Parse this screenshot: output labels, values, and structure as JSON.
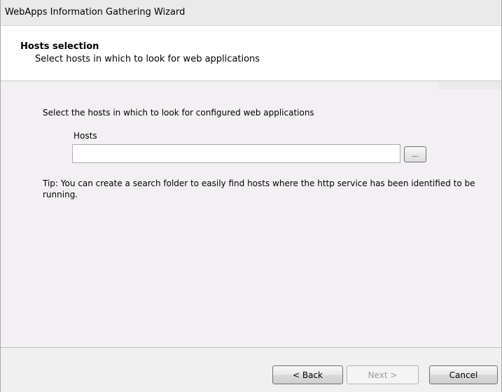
{
  "window": {
    "title": "WebApps Information Gathering Wizard"
  },
  "header": {
    "title": "Hosts selection",
    "subtitle": "Select hosts in which to look for web applications"
  },
  "main": {
    "intro": "Select the hosts in which to look for configured web applications",
    "hosts_label": "Hosts",
    "hosts_value": "",
    "browse_label": "...",
    "tip": "Tip: You can create a search folder to easily find hosts where the http service has been identified to be running."
  },
  "footer": {
    "back_label": "< Back",
    "next_label": "Next >",
    "cancel_label": "Cancel",
    "next_enabled": false
  }
}
